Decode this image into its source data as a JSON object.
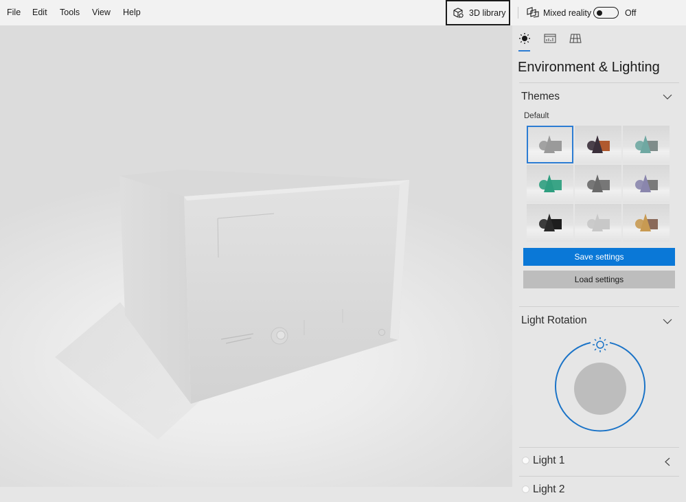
{
  "menu": {
    "items": [
      "File",
      "Edit",
      "Tools",
      "View",
      "Help"
    ]
  },
  "toolbar": {
    "library_label": "3D library",
    "library_icon": "cube-search-icon",
    "mixed_reality_label": "Mixed reality",
    "mixed_reality_icon": "mixed-reality-icon",
    "mixed_reality_state": "Off",
    "mixed_reality_on": false
  },
  "panel": {
    "tabs": [
      {
        "name": "environment-lighting",
        "icon": "sun-icon",
        "active": true
      },
      {
        "name": "statistics",
        "icon": "stats-chart-icon",
        "active": false
      },
      {
        "name": "grid",
        "icon": "grid-icon",
        "active": false
      }
    ],
    "title": "Environment & Lighting",
    "themes": {
      "title": "Themes",
      "selected_label": "Default",
      "items": [
        {
          "name": "default",
          "shape_color": "#9a9a9a",
          "box_color": "#9a9a9a",
          "selected": true
        },
        {
          "name": "dark-copper",
          "shape_color": "#3a2f3a",
          "box_color": "#b0592e",
          "selected": false
        },
        {
          "name": "teal-gray",
          "shape_color": "#6fa8a2",
          "box_color": "#7f8c8a",
          "selected": false
        },
        {
          "name": "green",
          "shape_color": "#2f9e80",
          "box_color": "#3aa486",
          "selected": false
        },
        {
          "name": "charcoal",
          "shape_color": "#6a6a6a",
          "box_color": "#777777",
          "selected": false
        },
        {
          "name": "lavender",
          "shape_color": "#8a86ad",
          "box_color": "#7a7a7a",
          "selected": false
        },
        {
          "name": "black",
          "shape_color": "#2a2a2a",
          "box_color": "#1e1e1e",
          "selected": false
        },
        {
          "name": "light",
          "shape_color": "#c8c8c8",
          "box_color": "#c8c8c8",
          "selected": false
        },
        {
          "name": "gold-purple",
          "shape_color": "#c89a52",
          "box_color": "#8a6a5a",
          "selected": false
        }
      ],
      "save_label": "Save settings",
      "load_label": "Load settings"
    },
    "light_rotation": {
      "title": "Light Rotation"
    },
    "lights": [
      {
        "label": "Light 1"
      },
      {
        "label": "Light 2"
      }
    ]
  },
  "colors": {
    "accent": "#0a78d7",
    "selection": "#2b7cd3",
    "panel_bg": "#e6e6e6",
    "menubar_bg": "#f2f2f2"
  }
}
